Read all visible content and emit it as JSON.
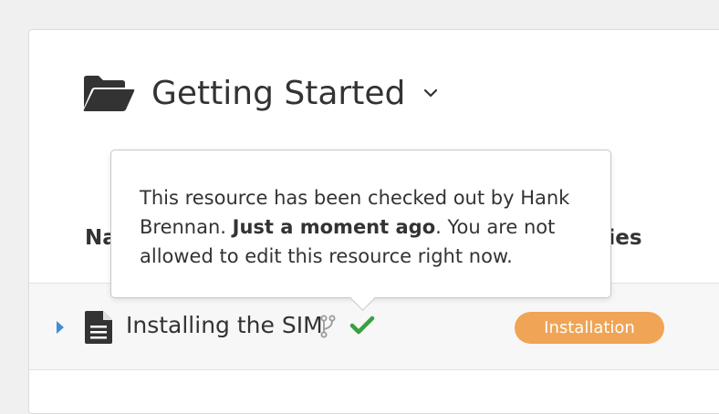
{
  "header": {
    "title": "Getting Started"
  },
  "columns": {
    "name": "Na",
    "categories": "nies"
  },
  "row": {
    "title": "Installing the SIM",
    "badge": "Installation"
  },
  "tooltip": {
    "text_before": "This resource has been checked out by Hank Brennan. ",
    "text_bold": "Just a moment ago",
    "text_after": ". You are not allowed to edit this resource right now."
  },
  "colors": {
    "badge": "#f0a455",
    "check": "#3aa040",
    "expander": "#3d8fd8"
  },
  "icons": {
    "folder": "folder-open-icon",
    "chevron": "chevron-down-icon",
    "document": "document-icon",
    "branch": "branch-icon",
    "check": "check-icon",
    "expander": "caret-right-icon"
  }
}
